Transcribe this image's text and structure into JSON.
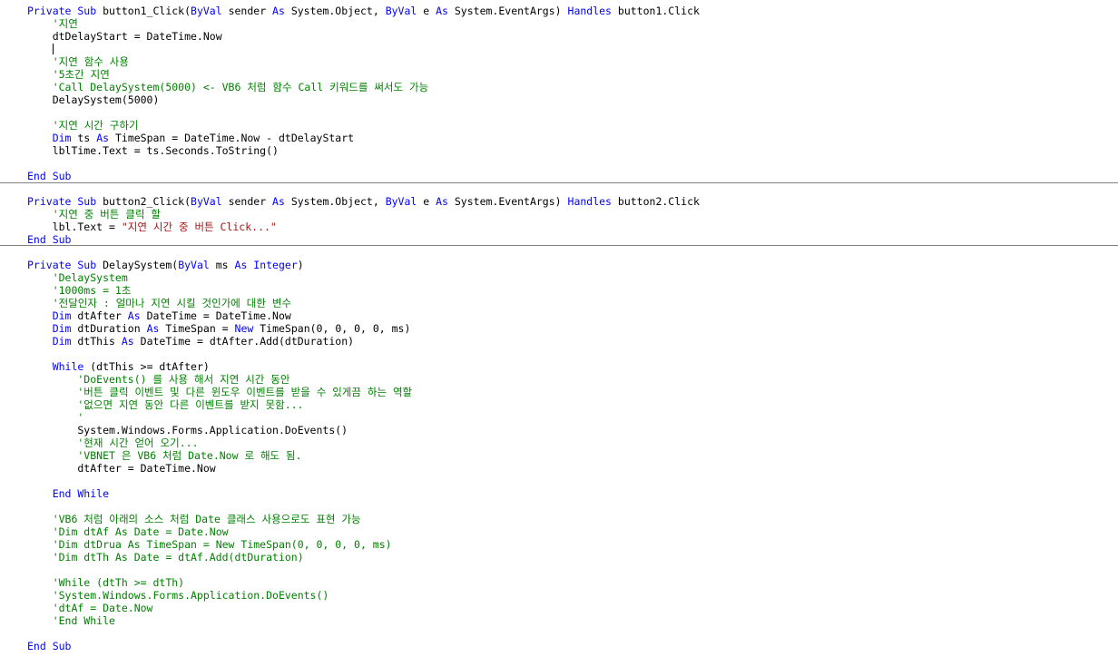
{
  "editor": {
    "colors": {
      "keyword": "#0000ff",
      "comment": "#008000",
      "string": "#a31515",
      "text": "#000000",
      "separator": "#808080"
    },
    "lines": [
      [
        {
          "t": "Private Sub ",
          "k": "kw"
        },
        {
          "t": "button1_Click(",
          "k": "pl"
        },
        {
          "t": "ByVal",
          "k": "kw"
        },
        {
          "t": " sender ",
          "k": "pl"
        },
        {
          "t": "As",
          "k": "kw"
        },
        {
          "t": " System.Object, ",
          "k": "pl"
        },
        {
          "t": "ByVal",
          "k": "kw"
        },
        {
          "t": " e ",
          "k": "pl"
        },
        {
          "t": "As",
          "k": "kw"
        },
        {
          "t": " System.EventArgs) ",
          "k": "pl"
        },
        {
          "t": "Handles",
          "k": "kw"
        },
        {
          "t": " button1.Click",
          "k": "pl"
        }
      ],
      [
        {
          "t": "    '지연",
          "k": "cm"
        }
      ],
      [
        {
          "t": "    dtDelayStart = DateTime.Now",
          "k": "pl"
        }
      ],
      [],
      [
        {
          "t": "    '지연 함수 사용",
          "k": "cm"
        }
      ],
      [
        {
          "t": "    '5초간 지연",
          "k": "cm"
        }
      ],
      [
        {
          "t": "    'Call DelaySystem(5000) <- VB6 처럼 함수 Call 키워드를 써서도 가능",
          "k": "cm"
        }
      ],
      [
        {
          "t": "    DelaySystem(5000)",
          "k": "pl"
        }
      ],
      [],
      [
        {
          "t": "    '지연 시간 구하기",
          "k": "cm"
        }
      ],
      [
        {
          "t": "    ",
          "k": "pl"
        },
        {
          "t": "Dim",
          "k": "kw"
        },
        {
          "t": " ts ",
          "k": "pl"
        },
        {
          "t": "As",
          "k": "kw"
        },
        {
          "t": " TimeSpan = DateTime.Now - dtDelayStart",
          "k": "pl"
        }
      ],
      [
        {
          "t": "    lblTime.Text = ts.Seconds.ToString()",
          "k": "pl"
        }
      ],
      [],
      [
        {
          "t": "End Sub",
          "k": "kw"
        }
      ],
      [],
      [
        {
          "t": "Private Sub ",
          "k": "kw"
        },
        {
          "t": "button2_Click(",
          "k": "pl"
        },
        {
          "t": "ByVal",
          "k": "kw"
        },
        {
          "t": " sender ",
          "k": "pl"
        },
        {
          "t": "As",
          "k": "kw"
        },
        {
          "t": " System.Object, ",
          "k": "pl"
        },
        {
          "t": "ByVal",
          "k": "kw"
        },
        {
          "t": " e ",
          "k": "pl"
        },
        {
          "t": "As",
          "k": "kw"
        },
        {
          "t": " System.EventArgs) ",
          "k": "pl"
        },
        {
          "t": "Handles",
          "k": "kw"
        },
        {
          "t": " button2.Click",
          "k": "pl"
        }
      ],
      [
        {
          "t": "    '지연 중 버튼 클릭 할",
          "k": "cm"
        }
      ],
      [
        {
          "t": "    lbl.Text = ",
          "k": "pl"
        },
        {
          "t": "\"지연 시간 중 버튼 Click...\"",
          "k": "st"
        }
      ],
      [
        {
          "t": "End Sub",
          "k": "kw"
        }
      ],
      [],
      [
        {
          "t": "Private Sub ",
          "k": "kw"
        },
        {
          "t": "DelaySystem(",
          "k": "pl"
        },
        {
          "t": "ByVal",
          "k": "kw"
        },
        {
          "t": " ms ",
          "k": "pl"
        },
        {
          "t": "As Integer",
          "k": "kw"
        },
        {
          "t": ")",
          "k": "pl"
        }
      ],
      [
        {
          "t": "    'DelaySystem",
          "k": "cm"
        }
      ],
      [
        {
          "t": "    '1000ms = 1초",
          "k": "cm"
        }
      ],
      [
        {
          "t": "    '전달인자 : 얼마나 지연 시킬 것인가에 대한 변수",
          "k": "cm"
        }
      ],
      [
        {
          "t": "    ",
          "k": "pl"
        },
        {
          "t": "Dim",
          "k": "kw"
        },
        {
          "t": " dtAfter ",
          "k": "pl"
        },
        {
          "t": "As",
          "k": "kw"
        },
        {
          "t": " DateTime = DateTime.Now",
          "k": "pl"
        }
      ],
      [
        {
          "t": "    ",
          "k": "pl"
        },
        {
          "t": "Dim",
          "k": "kw"
        },
        {
          "t": " dtDuration ",
          "k": "pl"
        },
        {
          "t": "As",
          "k": "kw"
        },
        {
          "t": " TimeSpan = ",
          "k": "pl"
        },
        {
          "t": "New",
          "k": "kw"
        },
        {
          "t": " TimeSpan(0, 0, 0, 0, ms)",
          "k": "pl"
        }
      ],
      [
        {
          "t": "    ",
          "k": "pl"
        },
        {
          "t": "Dim",
          "k": "kw"
        },
        {
          "t": " dtThis ",
          "k": "pl"
        },
        {
          "t": "As",
          "k": "kw"
        },
        {
          "t": " DateTime = dtAfter.Add(dtDuration)",
          "k": "pl"
        }
      ],
      [],
      [
        {
          "t": "    ",
          "k": "pl"
        },
        {
          "t": "While",
          "k": "kw"
        },
        {
          "t": " (dtThis >= dtAfter)",
          "k": "pl"
        }
      ],
      [
        {
          "t": "        'DoEvents() 를 사용 해서 지연 시간 동안",
          "k": "cm"
        }
      ],
      [
        {
          "t": "        '버튼 클릭 이벤트 및 다른 윈도우 이벤트를 받을 수 있게끔 하는 역할",
          "k": "cm"
        }
      ],
      [
        {
          "t": "        '없으면 지연 동안 다른 이벤트를 받지 못함...",
          "k": "cm"
        }
      ],
      [
        {
          "t": "        '",
          "k": "cm"
        }
      ],
      [
        {
          "t": "        System.Windows.Forms.Application.DoEvents()",
          "k": "pl"
        }
      ],
      [
        {
          "t": "        '현재 시간 얻어 오기...",
          "k": "cm"
        }
      ],
      [
        {
          "t": "        'VBNET 은 VB6 처럼 Date.Now 로 해도 됨.",
          "k": "cm"
        }
      ],
      [
        {
          "t": "        dtAfter = DateTime.Now",
          "k": "pl"
        }
      ],
      [],
      [
        {
          "t": "    End While",
          "k": "kw"
        }
      ],
      [],
      [
        {
          "t": "    'VB6 처럼 아래의 소스 처럼 Date 클래스 사용으로도 표현 가능",
          "k": "cm"
        }
      ],
      [
        {
          "t": "    'Dim dtAf As Date = Date.Now",
          "k": "cm"
        }
      ],
      [
        {
          "t": "    'Dim dtDrua As TimeSpan = New TimeSpan(0, 0, 0, 0, ms)",
          "k": "cm"
        }
      ],
      [
        {
          "t": "    'Dim dtTh As Date = dtAf.Add(dtDuration)",
          "k": "cm"
        }
      ],
      [],
      [
        {
          "t": "    'While (dtTh >= dtTh)",
          "k": "cm"
        }
      ],
      [
        {
          "t": "    'System.Windows.Forms.Application.DoEvents()",
          "k": "cm"
        }
      ],
      [
        {
          "t": "    'dtAf = Date.Now",
          "k": "cm"
        }
      ],
      [
        {
          "t": "    'End While",
          "k": "cm"
        }
      ],
      [],
      [
        {
          "t": "End Sub",
          "k": "kw"
        }
      ]
    ]
  }
}
